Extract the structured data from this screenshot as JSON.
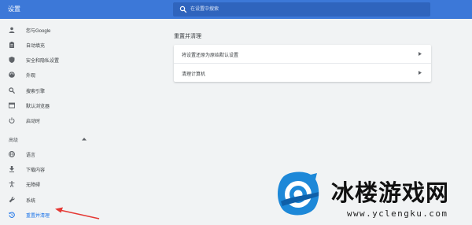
{
  "header": {
    "title": "设置",
    "search_placeholder": "在设置中搜索"
  },
  "sidebar": {
    "items": [
      {
        "label": "您与Google",
        "icon": "person-icon"
      },
      {
        "label": "自动填充",
        "icon": "clipboard-icon"
      },
      {
        "label": "安全和隐私设置",
        "icon": "shield-icon"
      },
      {
        "label": "外观",
        "icon": "palette-icon"
      },
      {
        "label": "搜索引擎",
        "icon": "search-icon"
      },
      {
        "label": "默认浏览器",
        "icon": "browser-icon"
      },
      {
        "label": "启动时",
        "icon": "power-icon"
      }
    ],
    "advanced_label": "高级",
    "advanced_items": [
      {
        "label": "语言",
        "icon": "globe-icon"
      },
      {
        "label": "下载内容",
        "icon": "download-icon"
      },
      {
        "label": "无障碍",
        "icon": "accessibility-icon"
      },
      {
        "label": "系统",
        "icon": "wrench-icon"
      },
      {
        "label": "重置并清理",
        "icon": "restore-icon",
        "active": true
      }
    ]
  },
  "main": {
    "section_title": "重置并清理",
    "rows": [
      {
        "label": "将设置还原为原始默认设置"
      },
      {
        "label": "清理计算机"
      }
    ]
  },
  "colors": {
    "header_bg": "#3c78d8",
    "accent": "#1a73e8",
    "annotation_arrow": "#e53935"
  },
  "watermark": {
    "name": "冰楼游戏网",
    "url": "www.yclengku.com"
  }
}
